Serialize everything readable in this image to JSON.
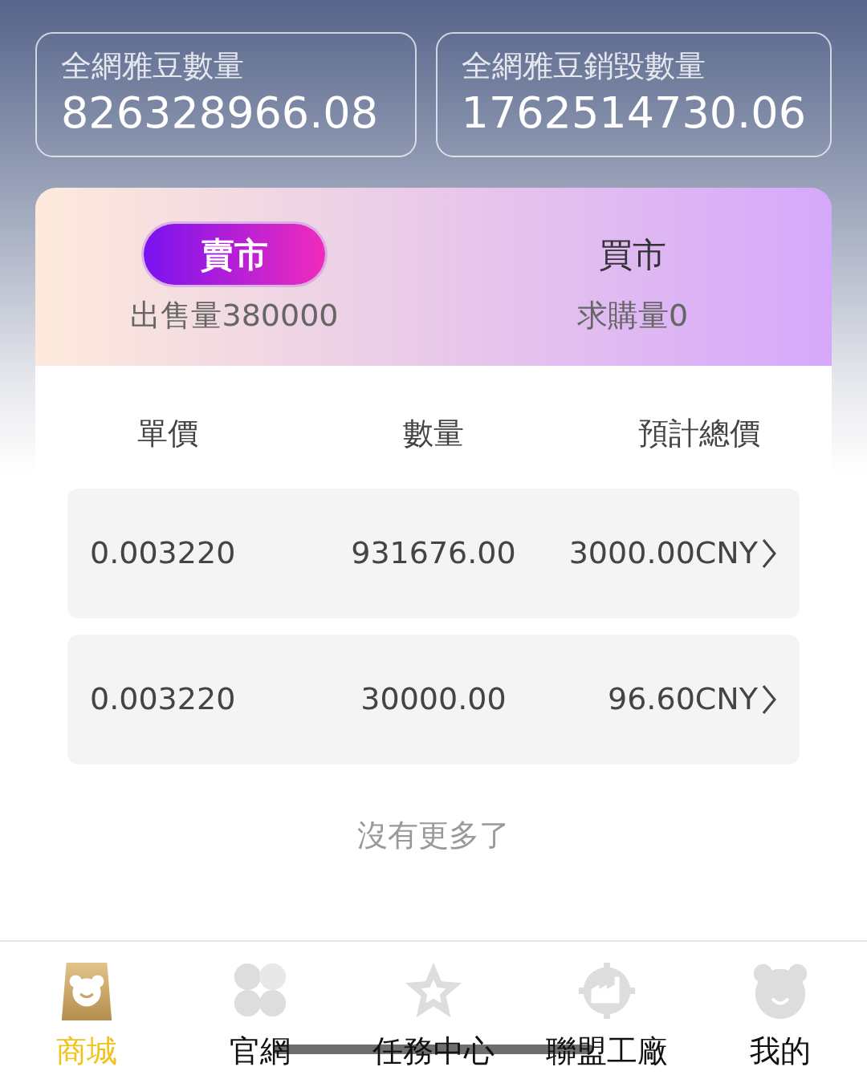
{
  "stats": [
    {
      "label": "全網雅豆數量",
      "value": "826328966.08"
    },
    {
      "label": "全網雅豆銷毀數量",
      "value": "1762514730.06"
    }
  ],
  "market_tabs": [
    {
      "label": "賣市",
      "sub": "出售量380000",
      "selected": true
    },
    {
      "label": "買市",
      "sub": "求購量0",
      "selected": false
    }
  ],
  "table": {
    "columns": [
      "單價",
      "數量",
      "預計總價"
    ],
    "rows": [
      {
        "price": "0.003220",
        "quantity": "931676.00",
        "total": "3000.00CNY"
      },
      {
        "price": "0.003220",
        "quantity": "30000.00",
        "total": "96.60CNY"
      }
    ]
  },
  "end_note": "沒有更多了",
  "nav": [
    {
      "label": "商城",
      "kind": "shop",
      "selected": true
    },
    {
      "label": "官網",
      "kind": "clover",
      "selected": false
    },
    {
      "label": "任務中心",
      "kind": "star",
      "selected": false
    },
    {
      "label": "聯盟工廠",
      "kind": "factory",
      "selected": false
    },
    {
      "label": "我的",
      "kind": "bear",
      "selected": false
    }
  ]
}
